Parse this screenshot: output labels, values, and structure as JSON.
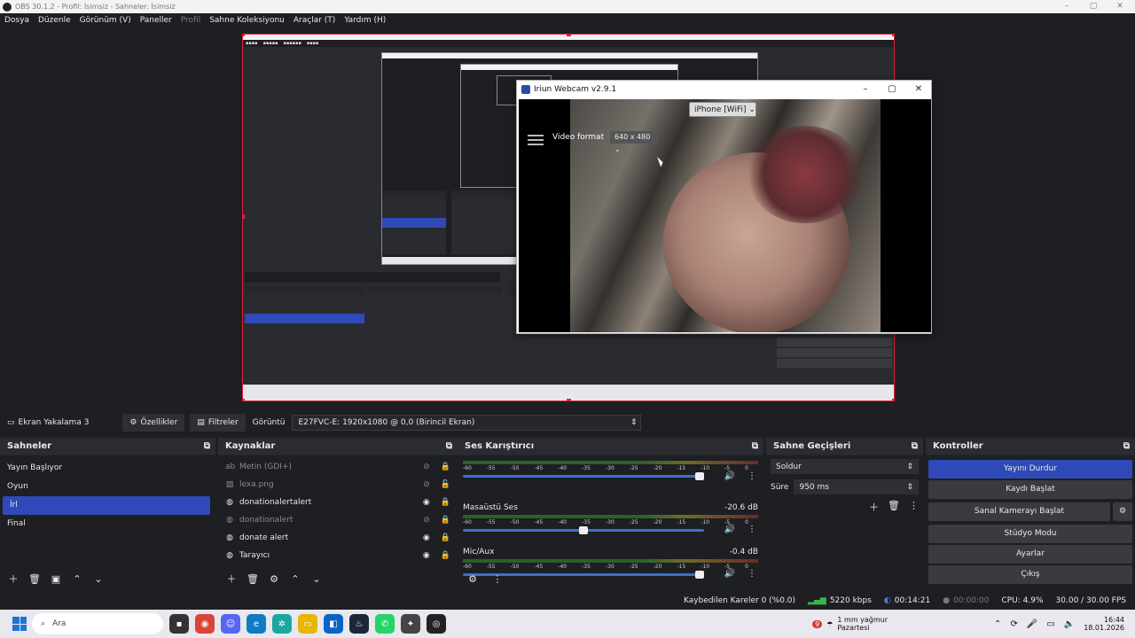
{
  "window": {
    "title": "OBS 30.1.2 - Profil: İsimsiz - Sahneler: İsimsiz",
    "min_icon": "minimize-icon",
    "max_icon": "maximize-icon",
    "close_icon": "close-icon"
  },
  "menu": [
    "Dosya",
    "Düzenle",
    "Görünüm (V)",
    "Paneller",
    "Profil",
    "Sahne Koleksiyonu",
    "Araçlar (T)",
    "Yardım (H)"
  ],
  "webcam_window": {
    "title": "Iriun Webcam v2.9.1",
    "device": "iPhone [WiFi]",
    "video_format_label": "Video format",
    "video_format_value": "640 x 480"
  },
  "source_bar": {
    "source_name": "Ekran Yakalama 3",
    "properties": "Özellikler",
    "filters": "Filtreler",
    "display_label": "Görüntü",
    "display_value": "E27FVC-E: 1920x1080 @ 0,0 (Birincil Ekran)"
  },
  "scenes": {
    "title": "Sahneler",
    "items": [
      "Yayın Başlıyor",
      "Oyun",
      "İrl",
      "Final"
    ],
    "selected": "İrl"
  },
  "sources": {
    "title": "Kaynaklar",
    "items": [
      {
        "name": "Metin (GDI+)",
        "visible": false,
        "locked": true,
        "dim": true,
        "icon": "text-icon"
      },
      {
        "name": "lexa.png",
        "visible": false,
        "locked": false,
        "dim": true,
        "icon": "image-icon"
      },
      {
        "name": "donationalertalert",
        "visible": true,
        "locked": true,
        "dim": false,
        "icon": "browser-icon"
      },
      {
        "name": "donationalert",
        "visible": false,
        "locked": true,
        "dim": true,
        "icon": "browser-icon"
      },
      {
        "name": "donate alert",
        "visible": true,
        "locked": true,
        "dim": false,
        "icon": "browser-icon"
      },
      {
        "name": "Tarayıcı",
        "visible": true,
        "locked": true,
        "dim": false,
        "icon": "browser-icon"
      }
    ]
  },
  "mixer": {
    "title": "Ses Karıştırıcı",
    "ticks": [
      "-60",
      "-55",
      "-50",
      "-45",
      "-40",
      "-35",
      "-30",
      "-25",
      "-20",
      "-15",
      "-10",
      "-5",
      "0"
    ],
    "tracks": [
      {
        "name": "",
        "db": "",
        "volume": 0.98
      },
      {
        "name": "Masaüstü Ses",
        "db": "-20.6 dB",
        "volume": 0.5
      },
      {
        "name": "Mic/Aux",
        "db": "-0.4 dB",
        "volume": 0.99
      }
    ]
  },
  "transitions": {
    "title": "Sahne Geçişleri",
    "type": "Soldur",
    "duration_label": "Süre",
    "duration_value": "950 ms"
  },
  "controls": {
    "title": "Kontroller",
    "buttons": [
      "Yayını Durdur",
      "Kaydı Başlat",
      "Sanal Kamerayı Başlat",
      "Stüdyo Modu",
      "Ayarlar",
      "Çıkış"
    ]
  },
  "status": {
    "dropped": "Kaybedilen Kareler 0 (%0.0)",
    "bitrate": "5220 kbps",
    "stream_time": "00:14:21",
    "rec_time": "00:00:00",
    "cpu": "CPU: 4.9%",
    "fps": "30.00 / 30.00 FPS"
  },
  "taskbar": {
    "search": "Ara",
    "weather_temp": "1 mm yağmur",
    "weather_day": "Pazartesi",
    "weather_badge": "9",
    "time": "16:44",
    "date": "18.01.2026"
  },
  "colors": {
    "accent": "#2f4ab8",
    "selection_border": "#e0203a"
  }
}
